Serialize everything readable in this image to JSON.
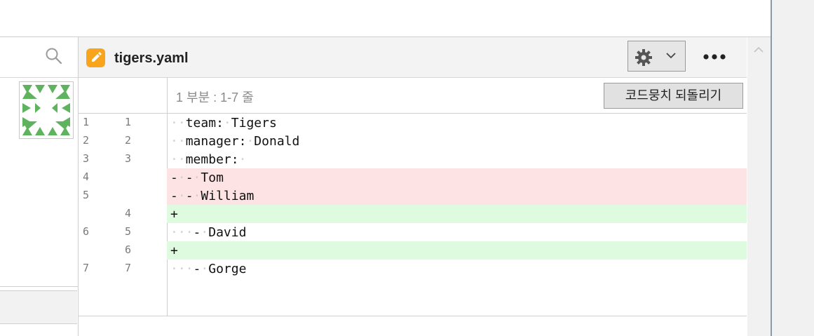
{
  "editor": {
    "file_name": "tigers.yaml",
    "hunk_label": "1 부분 : 1-7 줄",
    "revert_label": "코드뭉치 되돌리기",
    "more_label": "•••"
  },
  "lines": [
    {
      "old": "1",
      "new": "1",
      "code": "··team:·Tigers",
      "kind": "ctx"
    },
    {
      "old": "2",
      "new": "2",
      "code": "··manager:·Donald",
      "kind": "ctx"
    },
    {
      "old": "3",
      "new": "3",
      "code": "··member:·",
      "kind": "ctx"
    },
    {
      "old": "4",
      "new": "",
      "code": "-·-·Tom",
      "kind": "del"
    },
    {
      "old": "5",
      "new": "",
      "code": "-·-·William",
      "kind": "del"
    },
    {
      "old": "",
      "new": "4",
      "code": "+",
      "kind": "ins"
    },
    {
      "old": "6",
      "new": "5",
      "code": "···-·David",
      "kind": "ctx"
    },
    {
      "old": "",
      "new": "6",
      "code": "+",
      "kind": "ins"
    },
    {
      "old": "7",
      "new": "7",
      "code": "···-·Gorge",
      "kind": "ctx"
    }
  ],
  "colors": {
    "accent": "#f8a41c",
    "deleted_bg": "#fde3e4",
    "inserted_bg": "#dffbdf"
  },
  "icons": [
    "search-icon",
    "edit-pencil-icon",
    "gear-icon",
    "chevron-down-icon",
    "more-icon",
    "chevron-up-icon"
  ]
}
